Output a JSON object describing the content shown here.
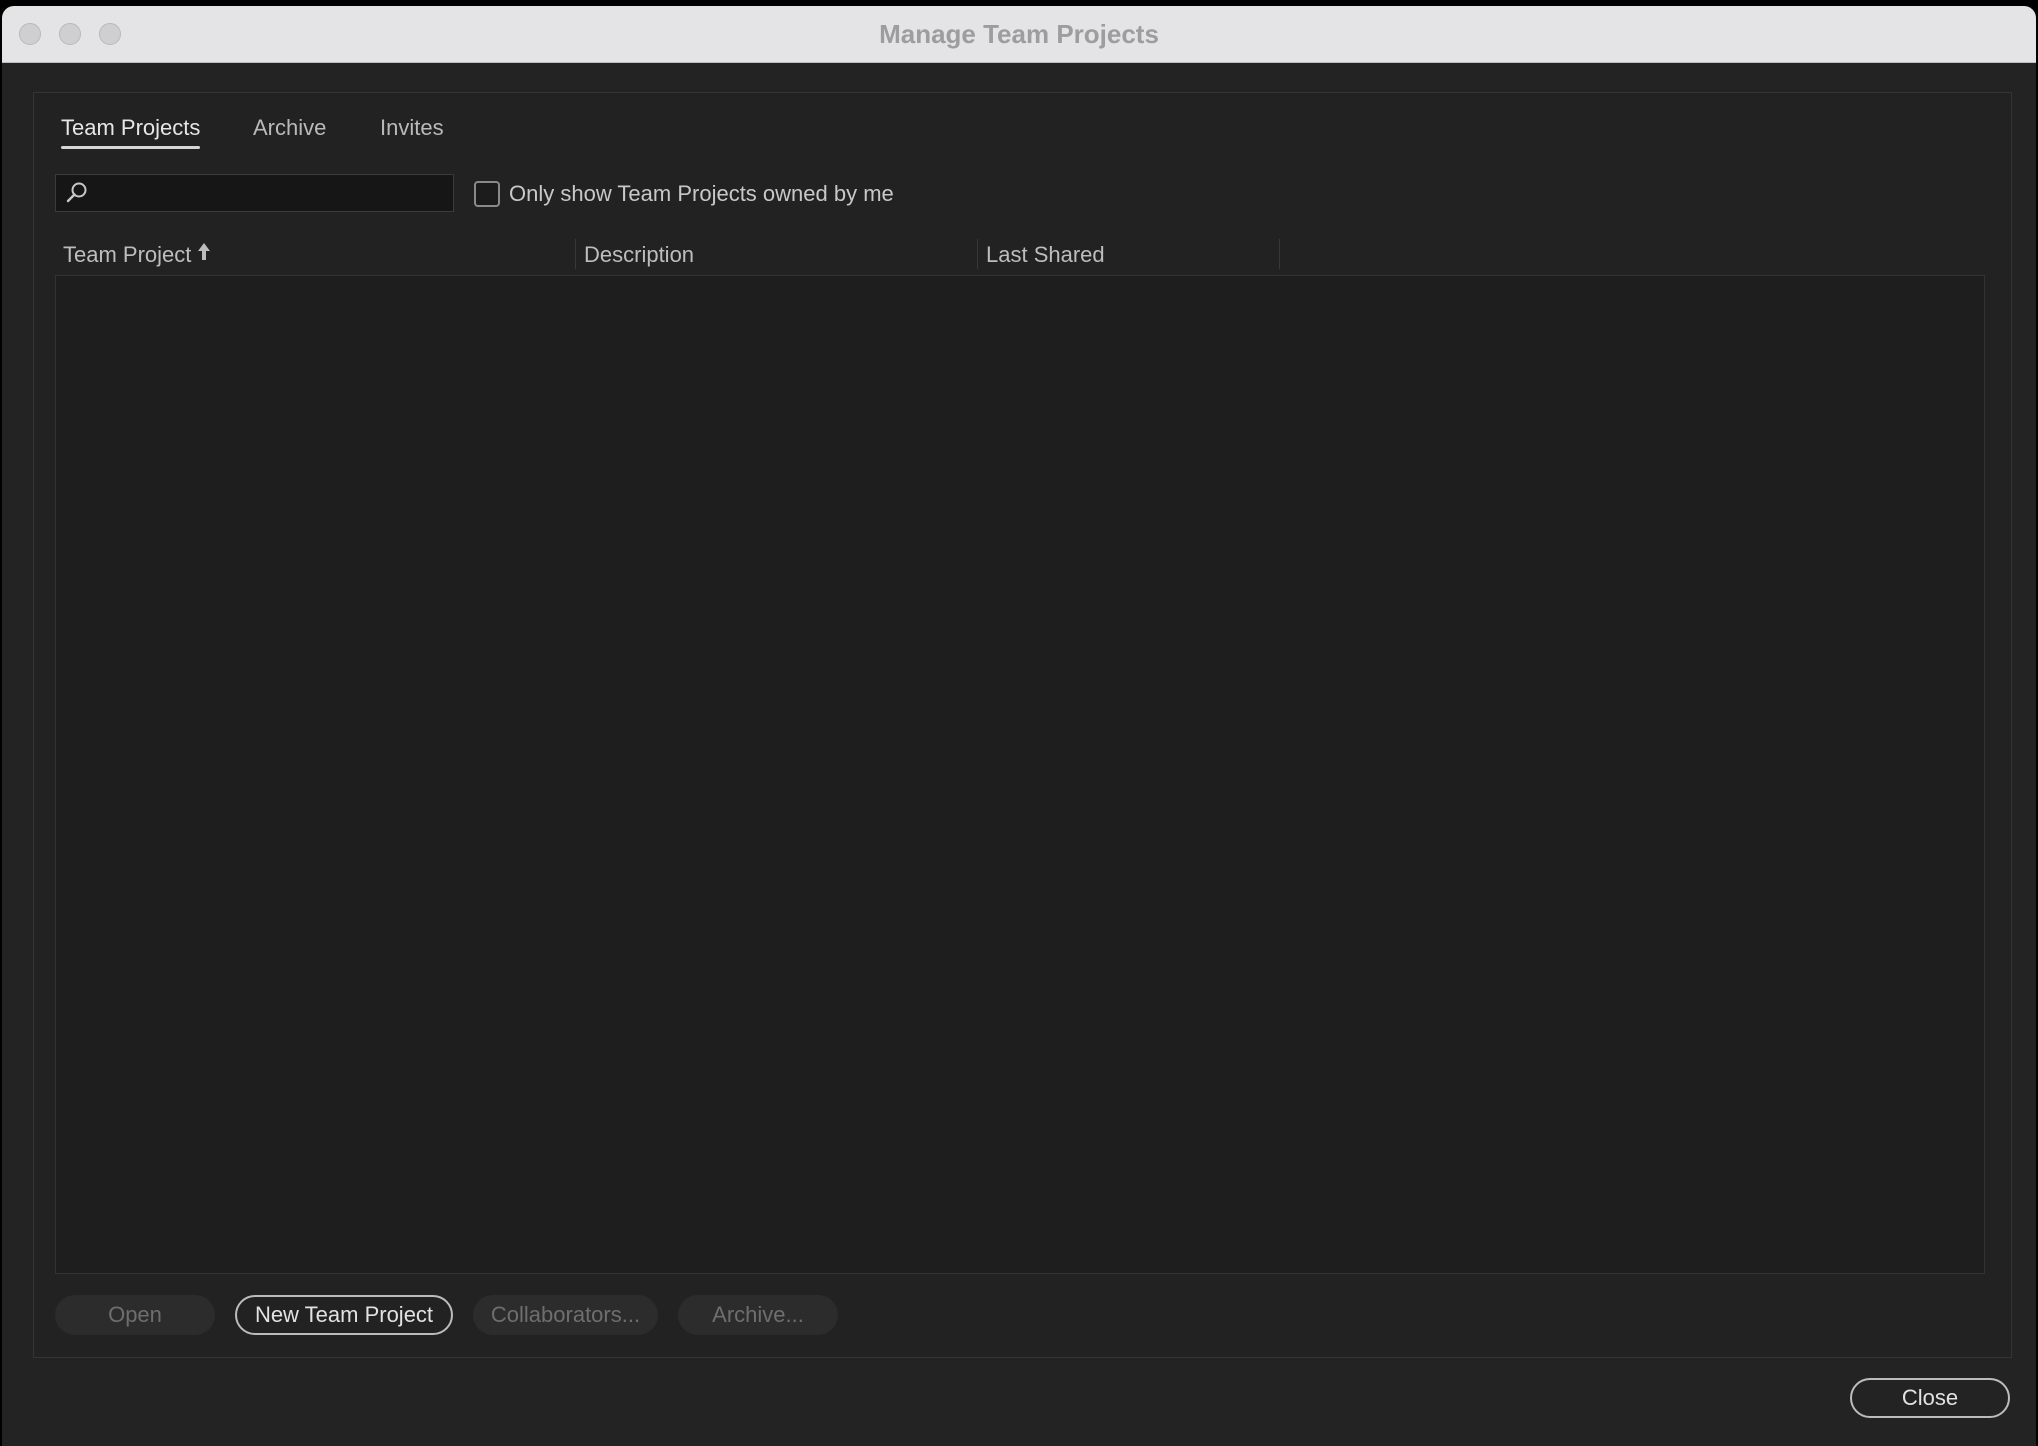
{
  "window": {
    "title": "Manage Team Projects"
  },
  "tabs": [
    {
      "label": "Team Projects",
      "active": true
    },
    {
      "label": "Archive",
      "active": false
    },
    {
      "label": "Invites",
      "active": false
    }
  ],
  "search": {
    "value": "",
    "placeholder": "",
    "icon": "search-icon"
  },
  "filter": {
    "checkbox_label": "Only show Team Projects owned by me",
    "checked": false
  },
  "table": {
    "columns": [
      {
        "label": "Team Project",
        "sort": "ascending"
      },
      {
        "label": "Description"
      },
      {
        "label": "Last Shared"
      }
    ],
    "rows": []
  },
  "actions": {
    "open": {
      "label": "Open",
      "enabled": false
    },
    "new_team_project": {
      "label": "New Team Project",
      "enabled": true
    },
    "collaborators": {
      "label": "Collaborators...",
      "enabled": false
    },
    "archive": {
      "label": "Archive...",
      "enabled": false
    }
  },
  "footer": {
    "close_label": "Close"
  }
}
